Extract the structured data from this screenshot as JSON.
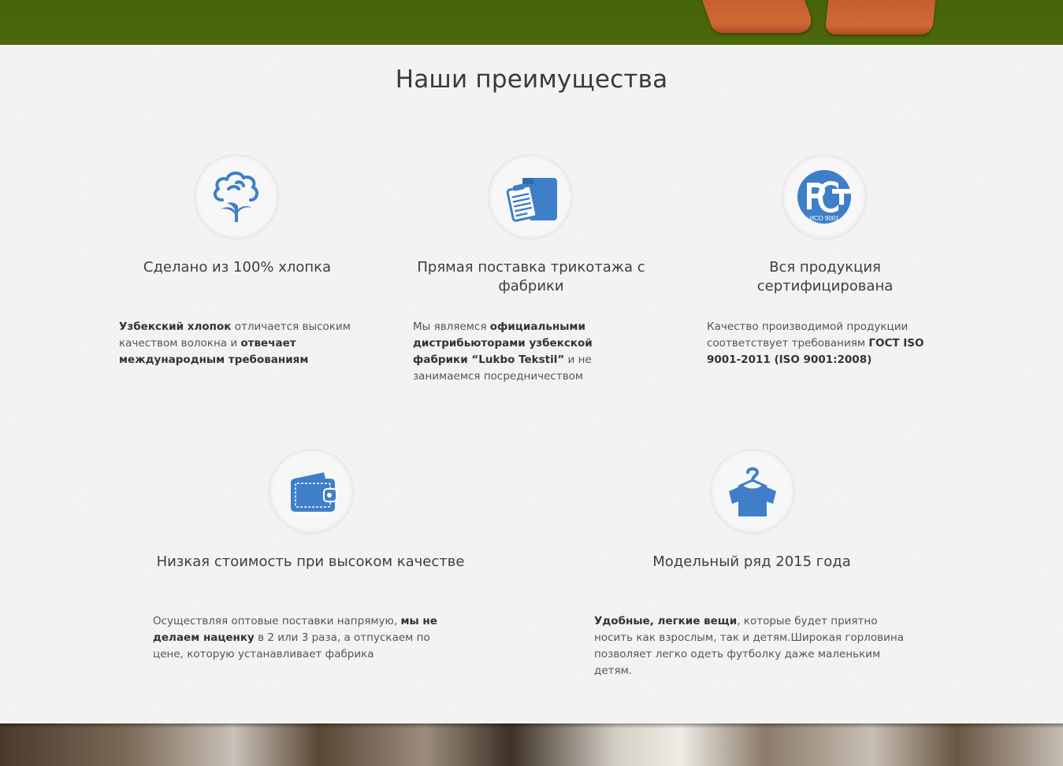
{
  "section": {
    "title": "Наши преимущества"
  },
  "colors": {
    "icon_blue": "#3f7fc9",
    "top_banner_green": "#4a660b",
    "text_dark": "#3e3e3e"
  },
  "features": [
    {
      "icon": "cotton-icon",
      "title": "Сделано из 100% хлопка",
      "desc": [
        {
          "t": "Узбекский хлопок",
          "b": true
        },
        {
          "t": " отличается высоким качеством волокна и ",
          "b": false
        },
        {
          "t": "отвечает международным требованиям",
          "b": true
        }
      ]
    },
    {
      "icon": "box-clipboard-icon",
      "title": "Прямая поставка трикотажа с фабрики",
      "desc": [
        {
          "t": "Мы являемся ",
          "b": false
        },
        {
          "t": "официальными дистрибьюторами узбекской фабрики “Lukbo Tekstil”",
          "b": true
        },
        {
          "t": " и не занимаемся посредничеством",
          "b": false
        }
      ]
    },
    {
      "icon": "pct-certificate-icon",
      "icon_label": "ИСО 9001",
      "title": "Вся продукция сертифицирована",
      "desc": [
        {
          "t": "Качество производимой продукции соответствует требованиям ",
          "b": false
        },
        {
          "t": "ГОСТ ISO 9001-2011 (ISO 9001:2008)",
          "b": true
        }
      ]
    },
    {
      "icon": "wallet-icon",
      "title": "Низкая стоимость при высоком качестве",
      "desc": [
        {
          "t": "Осуществляя оптовые поставки напрямую, ",
          "b": false
        },
        {
          "t": "мы не делаем наценку",
          "b": true
        },
        {
          "t": " в 2 или 3 раза, а отпускаем по цене, которую устанавливает фабрика",
          "b": false
        }
      ]
    },
    {
      "icon": "tshirt-hanger-icon",
      "title": "Модельный ряд 2015 года",
      "desc": [
        {
          "t": "Удобные, легкие вещи",
          "b": true
        },
        {
          "t": ", которые будет приятно носить как взрослым, так и детям.Широкая горловина позволяет легко одеть футболку даже маленьким детям.",
          "b": false
        }
      ]
    }
  ]
}
